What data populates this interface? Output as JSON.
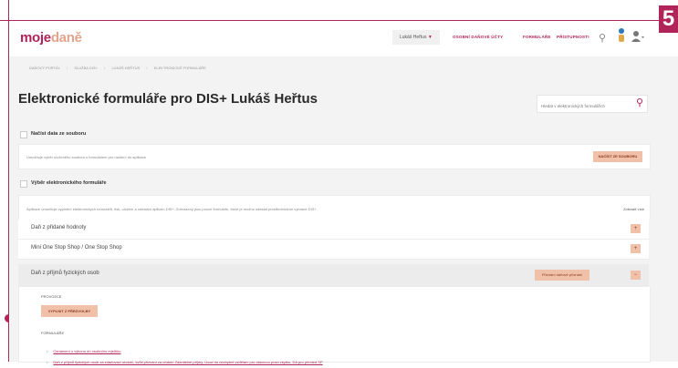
{
  "step_number": "5",
  "header": {
    "logo_main": "moje",
    "logo_accent": "daně",
    "user_name": "Lukáš Heřtus",
    "nav": [
      "OSOBNÍ DAŇOVÉ ÚČTY",
      "FORMULÁŘE",
      "PŘÍSTUPNOSTI"
    ]
  },
  "breadcrumb": [
    "DAŇOVÝ PORTÁL",
    "SLUŽBA DIS+",
    "LUKÁŠ HEŘTUS",
    "ELEKTRONICKÉ FORMULÁŘE"
  ],
  "page": {
    "title": "Elektronické formuláře pro DIS+ Lukáš Heřtus",
    "search_placeholder": "Hledat v elektronických formulářích"
  },
  "load_section": {
    "heading": "Načíst data ze souboru",
    "hint": "Umožňuje výběr uloženého souboru s formulářem pro načtení do aplikace",
    "button": "NAČÍST ZE SOUBORU"
  },
  "select_section": {
    "heading": "Výběr elektronického formuláře",
    "description": "Aplikace umožňuje vyplnění elektronických formulářů, tisk, uložení a odeslání aplikací DIS+. Zobrazeny jsou pouze formuláře, které je možno odeslat prostřednictvím vybrané DIS+.",
    "expand_all": "Zobrazit více",
    "rows": [
      {
        "label": "Daň z přidané hodnoty"
      },
      {
        "label": "Mini One Stop Shop / One Stop Shop"
      },
      {
        "label": "Daň z příjmů fyzických osob",
        "badge": "Přiznání daňové přiznání"
      }
    ],
    "expanded": {
      "provoz_label": "PROVOZCE",
      "provoz_button": "VYPLNIT Z PŘEDVOLBY",
      "forms_label": "FORMULÁŘE",
      "links": [
        "Oznámení o výkonu do osobního rejstříku",
        "Daň z příjmů fyzických osob za zdaňovací období, kvůli přiznání za období Zdanitelné příjmy, Úvod do nezbytné vzdělání pro obecnou praxi zbytku, DA pro přehled SP"
      ]
    }
  }
}
